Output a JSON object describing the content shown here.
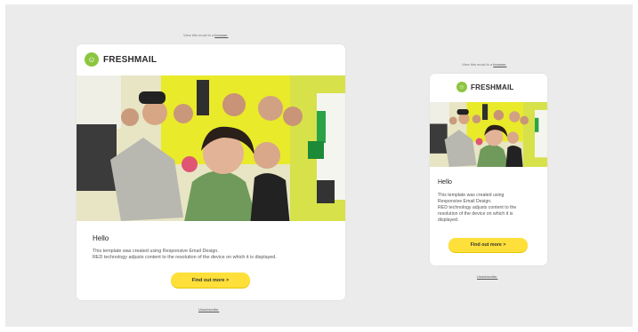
{
  "header_link": {
    "prefix": "View this email in a",
    "link": "browser."
  },
  "brand": {
    "name": "FRESHMAIL",
    "accent": "#8cc63f"
  },
  "photo": {
    "description_icon": "team-photo",
    "accent": "#e9ea2a"
  },
  "content": {
    "hello": "Hello",
    "line1": "This template was created using Responsive Email Design.",
    "line2": "RED technology adjusts content to the resolution of the device on which it is displayed.",
    "mobile_line1": "This template was created using",
    "mobile_line2": "Responsive Email Design.",
    "mobile_line3": "RED technology adjusts content to the",
    "mobile_line4": "resolution of the device on which it is",
    "mobile_line5": "displayed."
  },
  "cta": {
    "label": "Find out more  >",
    "color": "#ffe03a"
  },
  "footer": {
    "unsubscribe": "Unsubscribe."
  }
}
